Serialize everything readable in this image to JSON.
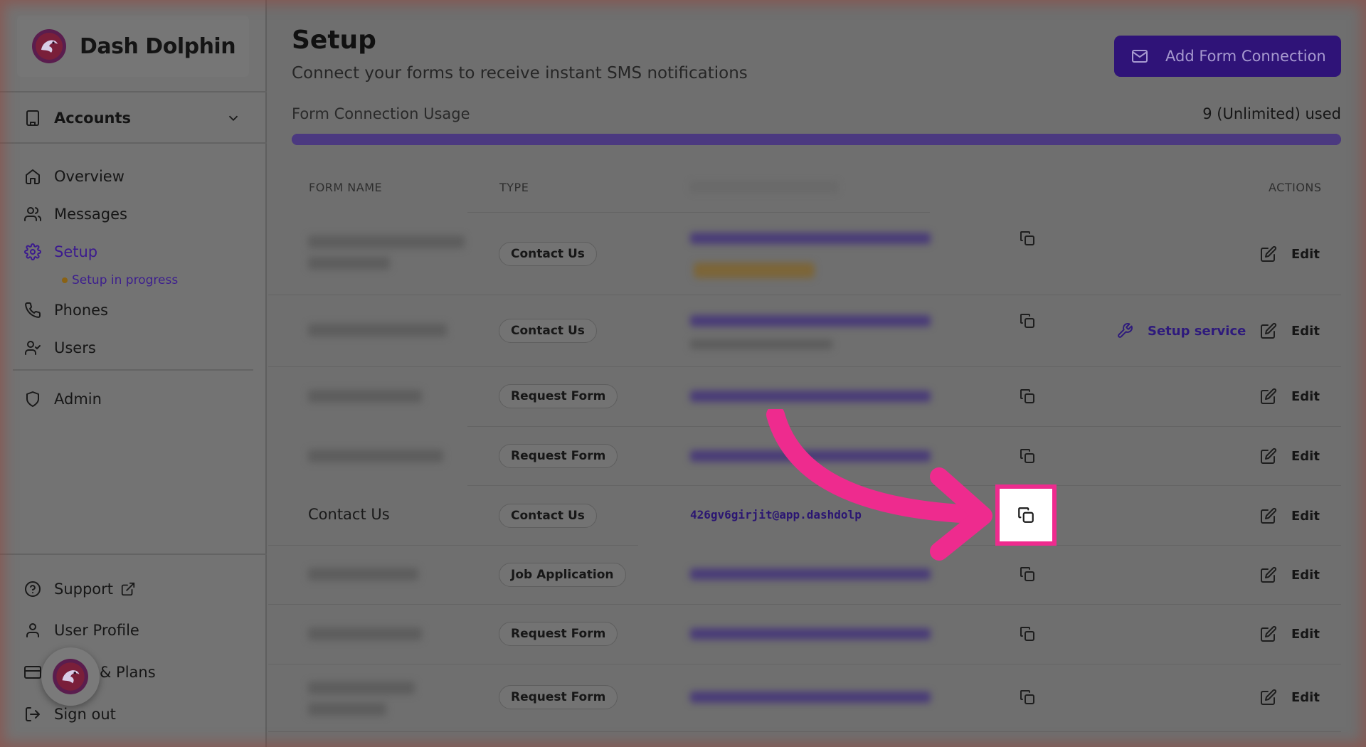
{
  "brand": {
    "name": "Dash Dolphin"
  },
  "sidebar": {
    "account_label": "Accounts",
    "items": [
      {
        "label": "Overview",
        "icon": "home-icon"
      },
      {
        "label": "Messages",
        "icon": "users-icon"
      },
      {
        "label": "Setup",
        "icon": "gear-icon",
        "active": true
      },
      {
        "label": "Phones",
        "icon": "phone-icon"
      },
      {
        "label": "Users",
        "icon": "user-check-icon"
      },
      {
        "label": "Admin",
        "icon": "shield-icon"
      }
    ],
    "setup_status": "Setup in progress",
    "bottom_items": [
      {
        "label": "Support",
        "icon": "help-circle-icon"
      },
      {
        "label": "User Profile",
        "icon": "user-icon"
      },
      {
        "label": "& Plans",
        "icon": "credit-card-icon"
      },
      {
        "label": "Sign out",
        "icon": "log-out-icon"
      }
    ]
  },
  "header": {
    "title": "Setup",
    "subtitle": "Connect your forms to receive instant SMS notifications",
    "add_button": "Add Form Connection"
  },
  "usage": {
    "label": "Form Connection Usage",
    "count": "9 (Unlimited) used",
    "fill_fraction": 1.0
  },
  "table": {
    "headers": {
      "form_name": "FORM NAME",
      "type": "TYPE",
      "actions": "ACTIONS"
    },
    "rows": [
      {
        "name": "",
        "type": "Contact Us",
        "email": "",
        "edit": "Edit"
      },
      {
        "name": "",
        "type": "Contact Us",
        "email": "",
        "edit": "Edit",
        "setup": "Setup service"
      },
      {
        "name": "",
        "type": "Request Form",
        "email": "",
        "edit": "Edit"
      },
      {
        "name": "",
        "type": "Request Form",
        "email": "",
        "edit": "Edit"
      },
      {
        "name": "Contact Us",
        "type": "Contact Us",
        "email": "426gv6girjit@app.dashdolp",
        "edit": "Edit"
      },
      {
        "name": "",
        "type": "Job Application",
        "email": "",
        "edit": "Edit"
      },
      {
        "name": "",
        "type": "Request Form",
        "email": "",
        "edit": "Edit"
      },
      {
        "name": "",
        "type": "Request Form",
        "email": "",
        "edit": "Edit"
      }
    ]
  },
  "colors": {
    "brand": "#5b2bd6",
    "highlight": "#ee2b8e",
    "arrow": "#ee2b8e"
  }
}
